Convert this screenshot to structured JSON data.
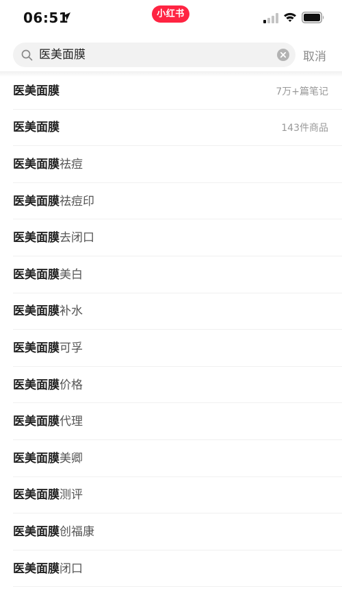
{
  "status_bar": {
    "time": "06:51",
    "app_badge": "小红书"
  },
  "search": {
    "query": "医美面膜",
    "cancel_label": "取消"
  },
  "colors": {
    "accent": "#ff2442",
    "search_bg": "#f2f2f2",
    "meta_text": "#999999"
  },
  "suggestions": [
    {
      "keyword": "医美面膜",
      "suffix": "",
      "meta": "7万+篇笔记"
    },
    {
      "keyword": "医美面膜",
      "suffix": "",
      "meta": "143件商品"
    },
    {
      "keyword": "医美面膜",
      "suffix": "祛痘",
      "meta": ""
    },
    {
      "keyword": "医美面膜",
      "suffix": "祛痘印",
      "meta": ""
    },
    {
      "keyword": "医美面膜",
      "suffix": "去闭口",
      "meta": ""
    },
    {
      "keyword": "医美面膜",
      "suffix": "美白",
      "meta": ""
    },
    {
      "keyword": "医美面膜",
      "suffix": "补水",
      "meta": ""
    },
    {
      "keyword": "医美面膜",
      "suffix": "可孚",
      "meta": ""
    },
    {
      "keyword": "医美面膜",
      "suffix": "价格",
      "meta": ""
    },
    {
      "keyword": "医美面膜",
      "suffix": "代理",
      "meta": ""
    },
    {
      "keyword": "医美面膜",
      "suffix": "美卿",
      "meta": ""
    },
    {
      "keyword": "医美面膜",
      "suffix": "测评",
      "meta": ""
    },
    {
      "keyword": "医美面膜",
      "suffix": "创福康",
      "meta": ""
    },
    {
      "keyword": "医美面膜",
      "suffix": "闭口",
      "meta": ""
    }
  ]
}
